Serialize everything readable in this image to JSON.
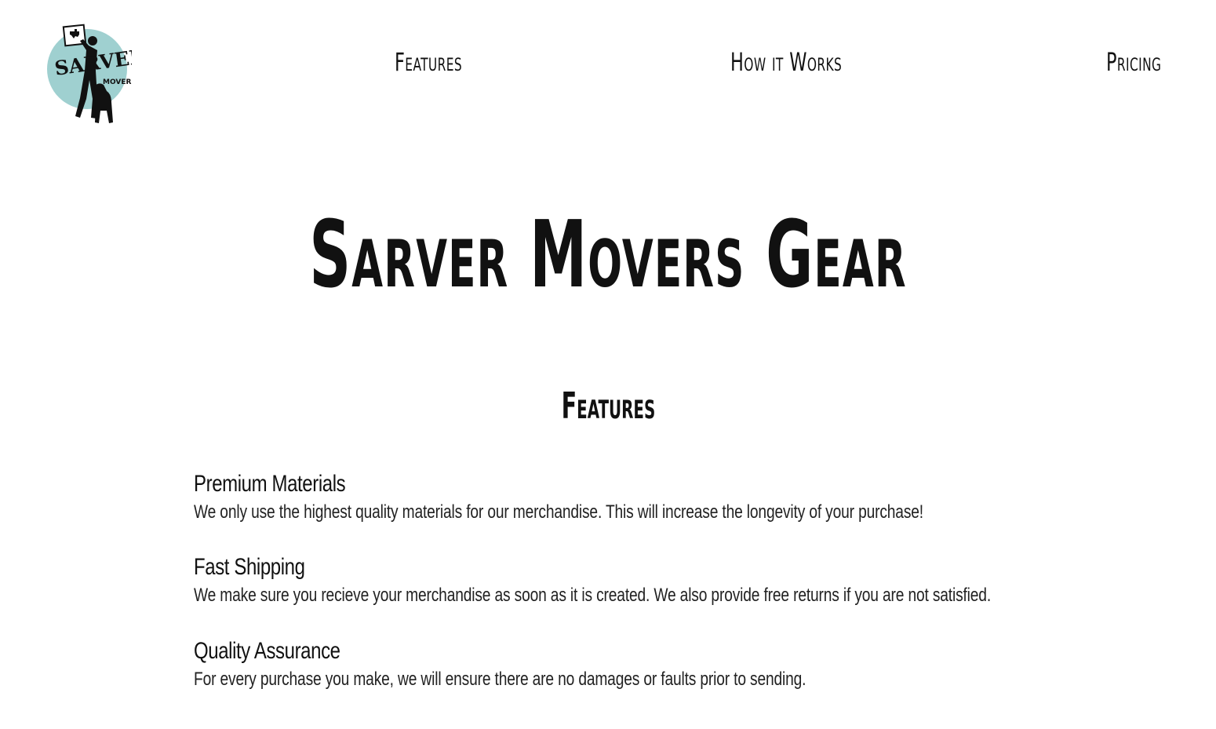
{
  "header": {
    "logo": {
      "icon": "sarver-movers-logo",
      "text_main": "SARVER",
      "text_sub": "MOVERS",
      "brand_color": "#9fd0d0"
    },
    "nav": {
      "features": "Features",
      "how_it_works": "How it Works",
      "pricing": "Pricing"
    }
  },
  "hero": {
    "title": "Sarver Movers Gear"
  },
  "features_section": {
    "title": "Features",
    "items": [
      {
        "title": "Premium Materials",
        "description": "We only use the highest quality materials for our merchandise. This will increase the longevity of your purchase!"
      },
      {
        "title": "Fast Shipping",
        "description": "We make sure you recieve your merchandise as soon as it is created. We also provide free returns if you are not satisfied."
      },
      {
        "title": "Quality Assurance",
        "description": "For every purchase you make, we will ensure there are no damages or faults prior to sending."
      }
    ]
  }
}
